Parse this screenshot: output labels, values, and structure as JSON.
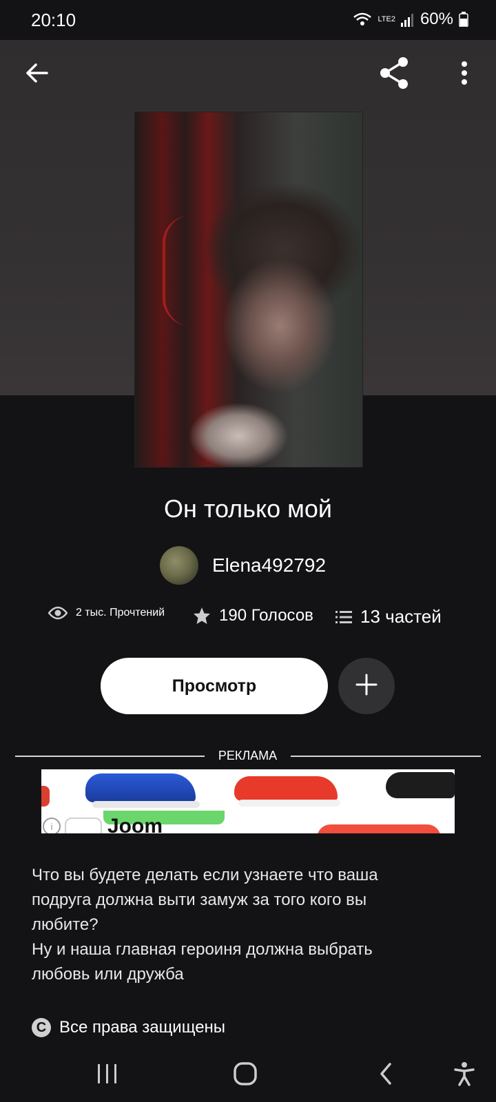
{
  "status_bar": {
    "time": "20:10",
    "network": "LTE2",
    "battery": "60%"
  },
  "top_bar": {
    "icons": [
      "back-arrow-icon",
      "share-icon",
      "more-vertical-icon"
    ]
  },
  "story": {
    "title": "Он только мой",
    "author": "Elena492792",
    "stats": {
      "reads": "2 тыс. Прочтений",
      "votes": "190 Голосов",
      "parts": "13 частей"
    },
    "view_button": "Просмотр",
    "description": "Что вы будете делать если узнаете что ваша\nподруга должна выти замуж за того кого вы\nлюбите?\nНу и наша главная героиня должна выбрать\nлюбовь или дружба",
    "copyright": "Все права защищены"
  },
  "ad": {
    "label": "РЕКЛАМА",
    "brand": "Joom"
  },
  "colors": {
    "background": "#131214",
    "hero": "#343132",
    "button_primary": "#ffffff",
    "button_secondary": "#313033"
  }
}
